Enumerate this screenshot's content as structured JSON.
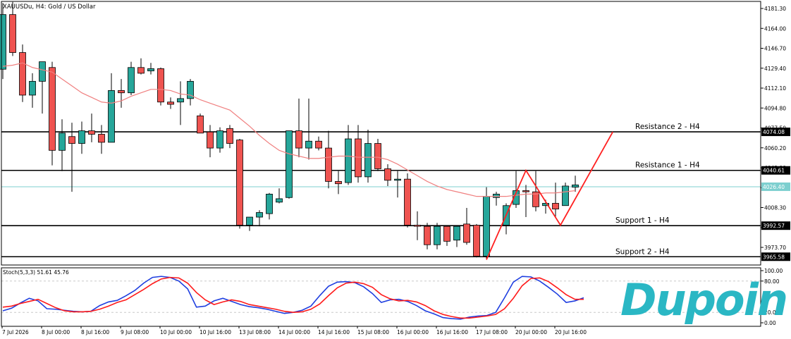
{
  "window": {
    "title": "XAUUSDu, H4:  Gold / US Dollar"
  },
  "chart_data": {
    "type": "candlestick",
    "symbol": "XAUUSDu",
    "timeframe": "H4",
    "description": "Gold / US Dollar",
    "y_ticks": [
      "4181.30",
      "4164.00",
      "4146.70",
      "4129.40",
      "4112.10",
      "4094.80",
      "4077.50",
      "4060.20",
      "4042.90",
      "4025.60",
      "4008.30",
      "3991.00",
      "3973.70"
    ],
    "y_range": [
      3958,
      4189
    ],
    "x_labels": [
      "7 Jul 2026",
      "8 Jul 00:00",
      "8 Jul 16:00",
      "9 Jul 08:00",
      "10 Jul 00:00",
      "10 Jul 16:00",
      "13 Jul 08:00",
      "14 Jul 00:00",
      "14 Jul 16:00",
      "15 Jul 08:00",
      "16 Jul 00:00",
      "16 Jul 16:00",
      "17 Jul 08:00",
      "20 Jul 00:00",
      "20 Jul 16:00"
    ],
    "candles": [
      {
        "o": 4128.5,
        "h": 4186,
        "l": 4120,
        "c": 4176
      },
      {
        "o": 4176,
        "h": 4187,
        "l": 4140,
        "c": 4143
      },
      {
        "o": 4143,
        "h": 4150,
        "l": 4100,
        "c": 4106
      },
      {
        "o": 4106,
        "h": 4125,
        "l": 4095,
        "c": 4118
      },
      {
        "o": 4118,
        "h": 4135,
        "l": 4090,
        "c": 4135
      },
      {
        "o": 4130,
        "h": 4135,
        "l": 4045,
        "c": 4058
      },
      {
        "o": 4058,
        "h": 4085,
        "l": 4040,
        "c": 4073
      },
      {
        "o": 4070,
        "h": 4082,
        "l": 4022,
        "c": 4064
      },
      {
        "o": 4064,
        "h": 4083,
        "l": 4055,
        "c": 4075
      },
      {
        "o": 4075,
        "h": 4090,
        "l": 4065,
        "c": 4072
      },
      {
        "o": 4072,
        "h": 4080,
        "l": 4055,
        "c": 4065
      },
      {
        "o": 4065,
        "h": 4125,
        "l": 4065,
        "c": 4110
      },
      {
        "o": 4110,
        "h": 4120,
        "l": 4095,
        "c": 4108
      },
      {
        "o": 4108,
        "h": 4135,
        "l": 4106,
        "c": 4130
      },
      {
        "o": 4130,
        "h": 4138,
        "l": 4124,
        "c": 4125
      },
      {
        "o": 4127,
        "h": 4134,
        "l": 4124,
        "c": 4129
      },
      {
        "o": 4129,
        "h": 4130,
        "l": 4097,
        "c": 4100
      },
      {
        "o": 4100,
        "h": 4104,
        "l": 4094,
        "c": 4098
      },
      {
        "o": 4100,
        "h": 4118,
        "l": 4080,
        "c": 4103
      },
      {
        "o": 4103,
        "h": 4120,
        "l": 4097,
        "c": 4118
      },
      {
        "o": 4088,
        "h": 4090,
        "l": 4073,
        "c": 4073
      },
      {
        "o": 4074,
        "h": 4080,
        "l": 4052,
        "c": 4060
      },
      {
        "o": 4060,
        "h": 4078,
        "l": 4056,
        "c": 4075
      },
      {
        "o": 4077,
        "h": 4080,
        "l": 4060,
        "c": 4064
      },
      {
        "o": 4067,
        "h": 4068,
        "l": 3990,
        "c": 3993
      },
      {
        "o": 3993,
        "h": 4000,
        "l": 3988,
        "c": 4000
      },
      {
        "o": 4000,
        "h": 4006,
        "l": 3992,
        "c": 4004
      },
      {
        "o": 4003,
        "h": 4021,
        "l": 3998,
        "c": 4020
      },
      {
        "o": 4013,
        "h": 4025,
        "l": 4012,
        "c": 4016
      },
      {
        "o": 4017,
        "h": 4075,
        "l": 4016,
        "c": 4075
      },
      {
        "o": 4075,
        "h": 4103,
        "l": 4052,
        "c": 4060
      },
      {
        "o": 4060,
        "h": 4103,
        "l": 4050,
        "c": 4066
      },
      {
        "o": 4066,
        "h": 4070,
        "l": 4058,
        "c": 4060
      },
      {
        "o": 4060,
        "h": 4075,
        "l": 4025,
        "c": 4031
      },
      {
        "o": 4031,
        "h": 4040,
        "l": 4020,
        "c": 4029
      },
      {
        "o": 4030,
        "h": 4080,
        "l": 4028,
        "c": 4068
      },
      {
        "o": 4068,
        "h": 4080,
        "l": 4030,
        "c": 4035
      },
      {
        "o": 4035,
        "h": 4076,
        "l": 4030,
        "c": 4064
      },
      {
        "o": 4064,
        "h": 4068,
        "l": 4040,
        "c": 4042
      },
      {
        "o": 4042,
        "h": 4046,
        "l": 4027,
        "c": 4032
      },
      {
        "o": 4032,
        "h": 4040,
        "l": 4017,
        "c": 4033
      },
      {
        "o": 4033,
        "h": 4038,
        "l": 3991,
        "c": 3993
      },
      {
        "o": 3993,
        "h": 4005,
        "l": 3980,
        "c": 3992
      },
      {
        "o": 3992,
        "h": 3995,
        "l": 3972,
        "c": 3976
      },
      {
        "o": 3976,
        "h": 3995,
        "l": 3972,
        "c": 3992
      },
      {
        "o": 3992,
        "h": 3993,
        "l": 3975,
        "c": 3979
      },
      {
        "o": 3980,
        "h": 3993,
        "l": 3974,
        "c": 3992
      },
      {
        "o": 3994,
        "h": 4008,
        "l": 3976,
        "c": 3978
      },
      {
        "o": 3993,
        "h": 3994,
        "l": 3965,
        "c": 3966
      },
      {
        "o": 3966,
        "h": 4026,
        "l": 3964,
        "c": 4018
      },
      {
        "o": 4017,
        "h": 4022,
        "l": 4010,
        "c": 4020
      },
      {
        "o": 3993,
        "h": 4012,
        "l": 3985,
        "c": 4010
      },
      {
        "o": 4011,
        "h": 4040,
        "l": 4008,
        "c": 4023
      },
      {
        "o": 4023,
        "h": 4028,
        "l": 4000,
        "c": 4022
      },
      {
        "o": 4022,
        "h": 4040,
        "l": 4005,
        "c": 4009
      },
      {
        "o": 4010,
        "h": 4015,
        "l": 4003,
        "c": 4012
      },
      {
        "o": 4012,
        "h": 4030,
        "l": 4000,
        "c": 4007
      },
      {
        "o": 4010,
        "h": 4030,
        "l": 4010,
        "c": 4027
      },
      {
        "o": 4026,
        "h": 4036,
        "l": 4022,
        "c": 4028
      }
    ],
    "ma_series": {
      "name": "",
      "values": [
        4131,
        4132,
        4134,
        4130,
        4128,
        4126,
        4120,
        4114,
        4108,
        4104,
        4100,
        4099,
        4101,
        4105,
        4108,
        4111,
        4111,
        4110,
        4107,
        4106,
        4102,
        4099,
        4096,
        4093,
        4086,
        4079,
        4071,
        4064,
        4058,
        4055,
        4053,
        4051,
        4051,
        4052,
        4053,
        4053,
        4052,
        4052,
        4052,
        4050,
        4046,
        4041,
        4036,
        4031,
        4027,
        4024,
        4022,
        4020,
        4018,
        4018,
        4018,
        4018,
        4019,
        4020,
        4020,
        4021,
        4021,
        4022,
        4023
      ]
    },
    "horizontal_levels": [
      {
        "name": "Resistance 2 - H4",
        "price_label": "4074.08",
        "value": 4074.08,
        "show_name": true
      },
      {
        "name": "Resistance 1 - H4",
        "price_label": "4040.61",
        "value": 4040.61,
        "show_name": true
      },
      {
        "name": "",
        "price_label": "4026.40",
        "value": 4026.4,
        "show_name": false
      },
      {
        "name": "Support 1 - H4",
        "price_label": "3992.57",
        "value": 3992.57,
        "show_name": true
      },
      {
        "name": "Support 2 - H4",
        "price_label": "3965.58",
        "value": 3965.58,
        "show_name": true
      }
    ],
    "projection_path": [
      {
        "i": 49,
        "v": 3963
      },
      {
        "i": 53,
        "v": 4040.6
      },
      {
        "i": 56.5,
        "v": 3993
      },
      {
        "i": 61.8,
        "v": 4074
      }
    ],
    "stochastic": {
      "label": "Stoch(5,3,3) 51.61 45.76",
      "y_ticks": [
        "100.00",
        "80.00",
        "20.00",
        "0.00"
      ],
      "k_values": [
        23,
        28,
        38,
        47,
        42,
        27,
        26,
        24,
        22,
        21,
        22,
        33,
        40,
        43,
        52,
        62,
        76,
        87,
        89,
        87,
        80,
        65,
        30,
        32,
        42,
        47,
        41,
        35,
        31,
        29,
        26,
        22,
        18,
        20,
        24,
        32,
        52,
        70,
        78,
        79,
        77,
        69,
        56,
        39,
        44,
        45,
        41,
        33,
        23,
        17,
        10,
        8,
        7,
        11,
        13,
        14,
        20,
        48,
        78,
        89,
        88,
        80,
        68,
        55,
        39,
        42,
        48
      ],
      "d_values": [
        30,
        32,
        37,
        41,
        45,
        37,
        29,
        23,
        21,
        21,
        22,
        26,
        32,
        39,
        44,
        54,
        64,
        75,
        84,
        87,
        86,
        76,
        58,
        44,
        35,
        40,
        44,
        41,
        35,
        32,
        29,
        26,
        22,
        20,
        21,
        26,
        36,
        52,
        67,
        76,
        78,
        75,
        68,
        54,
        46,
        42,
        43,
        40,
        33,
        23,
        16,
        12,
        9,
        9,
        11,
        13,
        16,
        27,
        47,
        71,
        85,
        86,
        79,
        67,
        54,
        45,
        45
      ]
    }
  },
  "logo": {
    "text": "Dupoin",
    "color": "#2ab7c4"
  },
  "colors": {
    "bull": "#26a69a",
    "bear": "#ef5350",
    "ma": "#f08080",
    "level": "#000000",
    "current_price_line": "#7dcfcf",
    "projection": "#ff2020",
    "stoch_k": "#1e3ee0",
    "stoch_d": "#ff1a1a",
    "grid_dash": "#c8c8c8"
  }
}
